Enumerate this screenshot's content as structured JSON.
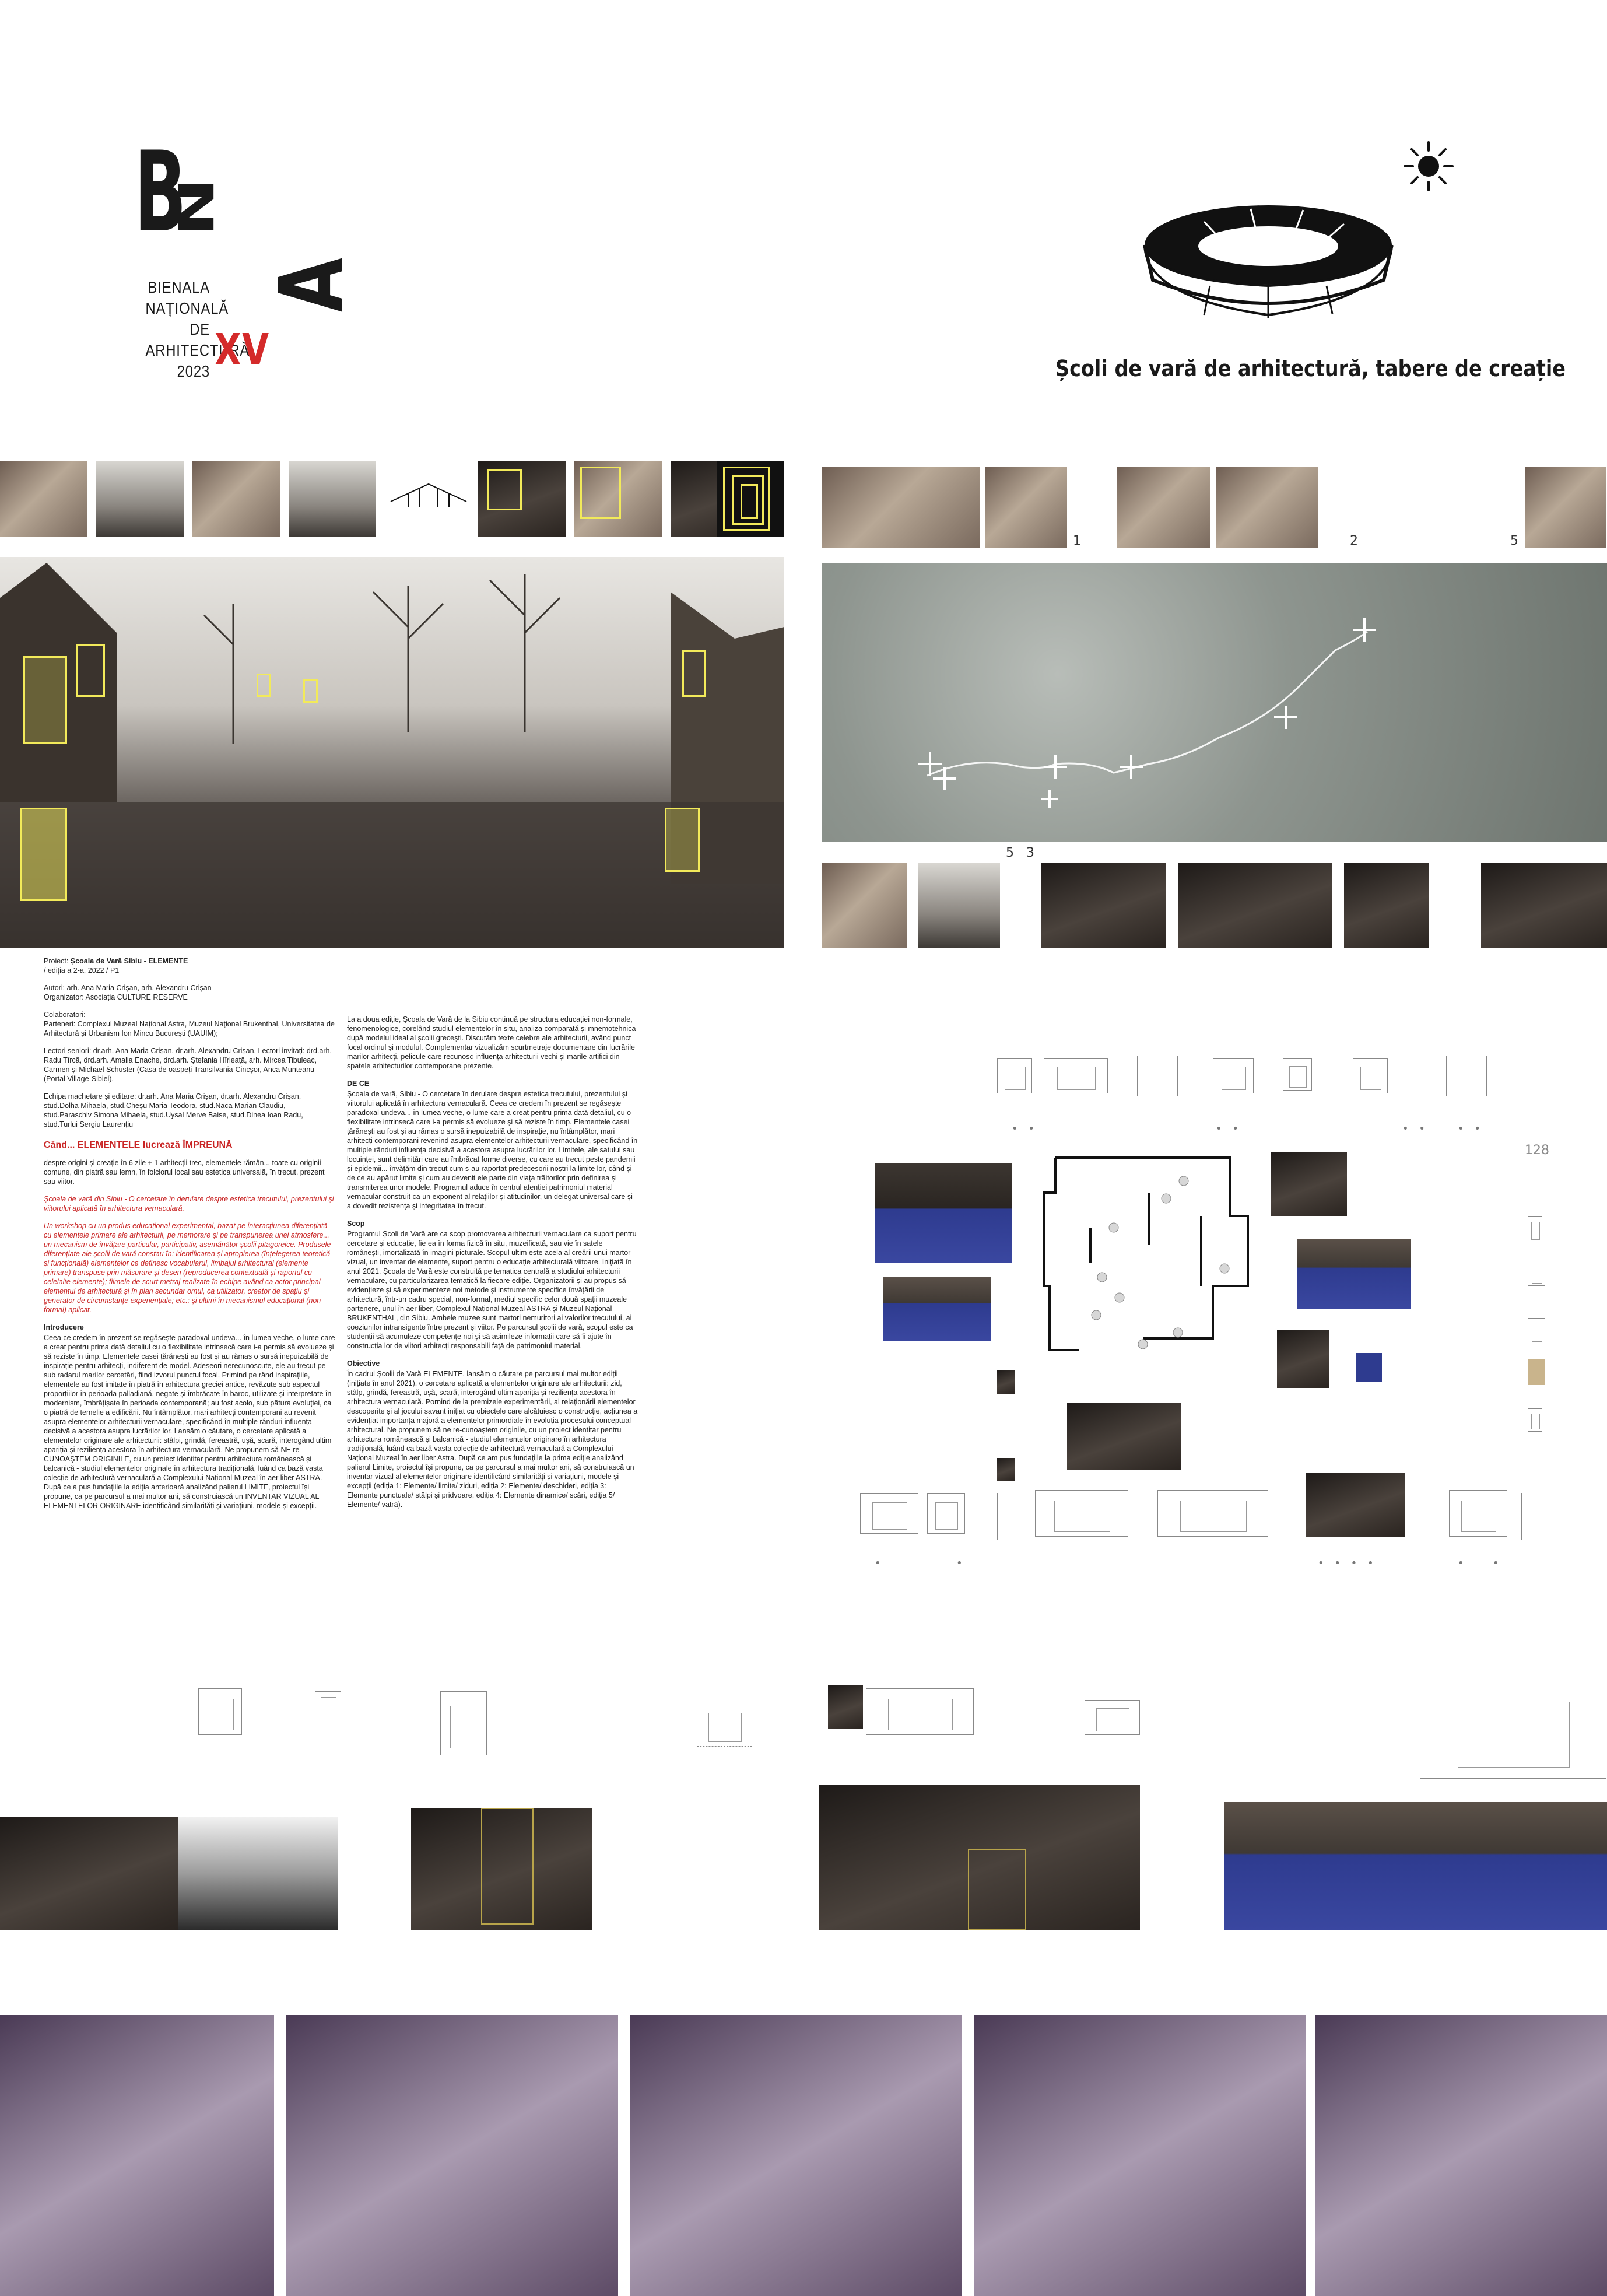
{
  "header": {
    "logo": {
      "b": "B",
      "n": "N",
      "a": "A",
      "lines": [
        "BIENALA",
        "NAȚIONALĂ",
        "DE",
        "ARHITECTURĂ",
        "2023"
      ],
      "edition": "XV"
    },
    "section_title": "Școli de vară de arhitectură, tabere de creație",
    "icons": [
      "sun-icon",
      "ring-pavilion-icon"
    ]
  },
  "map_markers": [
    "1",
    "2",
    "5"
  ],
  "strip_markers": [
    "5",
    "3"
  ],
  "drawing_label": "128",
  "project": {
    "title_prefix": "Proiect: ",
    "title": "Școala de Vară Sibiu - ELEMENTE",
    "edition": "/ ediția a 2-a, 2022 / P1",
    "authors": "Autori: arh. Ana Maria Crișan, arh. Alexandru Crișan",
    "organizer": "Organizator: Asociația CULTURE RESERVE",
    "collab_title": "Colaboratori:",
    "partners": "Parteneri: Complexul Muzeal Național Astra, Muzeul Național Brukenthal, Universitatea de Arhitectură și Urbanism Ion Mincu București (UAUIM);",
    "lecturers": "Lectori seniori: dr.arh. Ana Maria Crișan, dr.arh. Alexandru Crișan. Lectori invitați: drd.arh. Radu Tîrcă, drd.arh. Amalia Enache, drd.arh. Ștefania Hîrleață, arh. Mircea Tibuleac, Carmen și Michael Schuster (Casa de oaspeți Transilvania-Cincșor, Anca Munteanu (Portal Village-Sibiel).",
    "team": "Echipa machetare și editare: dr.arh. Ana Maria Crișan, dr.arh. Alexandru Crișan, stud.Dolha Mihaela, stud.Cheșu Maria Teodora, stud.Naca Marian Claudiu, stud.Paraschiv Simona Mihaela, stud.Uysal Merve Baise, stud.Dinea Ioan Radu, stud.Turlui Sergiu Laurențiu",
    "headline": "Când... ELEMENTELE lucrează ÎMPREUNĂ",
    "poem": "despre origini și creație în 6 zile + 1 arhitecții trec, elementele rămân... toate cu originii comune, din piatră sau lemn, în folclorul local sau estetica universală, în trecut, prezent sau viitor.",
    "red1": "Școala de vară din Sibiu - O cercetare în derulare despre estetica trecutului, prezentului și viitorului aplicată în arhitectura vernaculară.",
    "red2": "Un workshop cu un produs educațional experimental, bazat pe interacțiunea diferențiată cu elementele primare ale arhitecturii, pe memorare și pe transpunerea unei atmosfere... un mecanism de învățare particular, participativ, asemănător școlii pitagoreice. Produsele diferențiate ale școlii de vară constau în: identificarea și apropierea (înțelegerea teoretică și funcțională) elementelor ce definesc vocabularul, limbajul arhitectural (elemente primare) transpuse prin măsurare și desen (reproducerea contextuală și raportul cu celelalte elemente); filmele de scurt metraj realizate în echipe având ca actor principal elementul de arhitectură și în plan secundar omul, ca utilizator, creator de spațiu și generator de circumstanțe experiențiale; etc.; și ultimi în mecanismul educațional (non-formal) aplicat.",
    "intro_title": "Introducere",
    "intro": "Ceea ce credem în prezent se regăsește paradoxal undeva... în lumea veche, o lume care a creat pentru prima dată detaliul cu o flexibilitate intrinsecă care i-a permis să evolueze și să reziste în timp. Elementele casei țărănești au fost și au rămas o sursă inepuizabilă de inspirație pentru arhitecți, indiferent de model. Adeseori nerecunoscute, ele au trecut pe sub radarul marilor cercetări, fiind izvorul punctul focal. Primind pe rând inspirațiile, elementele au fost imitate în piatră în arhitectura greciei antice, revăzute sub aspectul proporțiilor în perioada palladiană, negate și îmbrăcate în baroc, utilizate și interpretate în modernism, îmbrățișate în perioada contemporană; au fost acolo, sub pătura evoluției, ca o piatră de temelie a edificării. Nu întâmplător, mari arhitecți contemporani au revenit asupra elementelor arhitecturii vernaculare, specificând în multiple rânduri influența decisivă a acestora asupra lucrărilor lor. Lansăm o căutare, o cercetare aplicată a elementelor originare ale arhitecturii: stâlpi, grindă, fereastră, ușă, scară, interogând ultim apariția și reziliența acestora în arhitectura vernaculară. Ne propunem să NE re-CUNOAȘTEM ORIGINILE, cu un proiect identitar pentru arhitectura românească și balcanică - studiul elementelor originale în arhitectura tradițională, luând ca bază vasta colecție de arhitectură vernaculară a Complexului Național Muzeal în aer liber ASTRA. După ce a pus fundațiile la ediția anterioară analizând palierul LIMITE, proiectul își propune, ca pe parcursul a mai multor ani, să construiască un INVENTAR VIZUAL AL ELEMENTELOR ORIGINARE identificând similarități și variațiuni, modele și excepții.",
    "c2_intro": "La a doua ediție, Școala de Vară de la Sibiu continuă pe structura educației non-formale, fenomenologice, corelând studiul elementelor în situ, analiza comparată și mnemotehnica după modelul ideal al școlii grecești. Discutăm texte celebre ale arhitecturii, având punct focal ordinul și modulul. Complementar vizualizăm scurtmetraje documentare din lucrările marilor arhitecți, pelicule care recunosc influența arhitecturii vechi și marile artifici din spatele arhitecturilor contemporane prezente.",
    "dece_title": "DE CE",
    "dece": "Școala de vară, Sibiu - O cercetare în derulare despre estetica trecutului, prezentului și viitorului aplicată în arhitectura vernaculară. Ceea ce credem în prezent se regăsește paradoxal undeva... în lumea veche, o lume care a creat pentru prima dată detaliul, cu o flexibilitate intrinsecă care i-a permis să evolueze și să reziste în timp. Elementele casei țărănești au fost și au rămas o sursă inepuizabilă de inspirație, nu întâmplător, mari arhitecți contemporani revenind asupra elementelor arhitecturii vernaculare, specificând în multiple rânduri influența decisivă a acestora asupra lucrărilor lor. Limitele, ale satului sau locuinței, sunt delimitări care au îmbrăcat forme diverse, cu care au trecut peste pandemii și epidemii... învățăm din trecut cum s-au raportat predecesorii noștri la limite lor, când și de ce au apărut limite și cum au devenit ele parte din viața trăitorilor prin definirea și transmiterea unor modele. Programul aduce în centrul atenției patrimoniul material vernacular construit ca un exponent al relațiilor și atitudinilor, un delegat universal care și-a dovedit rezistența și integritatea în trecut.",
    "scop_title": "Scop",
    "scop": "Programul Școli de Vară are ca scop promovarea arhitecturii vernaculare ca suport pentru cercetare și educație, fie ea în forma fizică în situ, muzeificată, sau vie în satele românești, imortalizată în imagini picturale. Scopul ultim este acela al creării unui martor vizual, un inventar de elemente, suport pentru o educație arhitecturală viitoare. Inițiată în anul 2021, Școala de Vară este construită pe tematica centrală a studiului arhitecturii vernaculare, cu particularizarea tematică la fiecare ediție. Organizatorii și au propus să evidențieze și să experimenteze noi metode și instrumente specifice învățării de arhitectură, într-un cadru special, non-formal, mediul specific celor două spații muzeale partenere, unul în aer liber, Complexul Național Muzeal ASTRA și Muzeul Național BRUKENTHAL, din Sibiu. Ambele muzee sunt martori nemuritori ai valorilor trecutului, ai coeziunilor intransigente între prezent și viitor. Pe parcursul școlii de vară, scopul este ca studenții să acumuleze competențe noi și să asimileze informații care să îi ajute în construcția lor de viitori arhitecți responsabili față de patrimoniul material.",
    "obiective_title": "Obiective",
    "obiective": "În cadrul Școlii de Vară ELEMENTE, lansăm o căutare pe parcursul mai multor ediții (inițiate în anul 2021), o cercetare aplicată a elementelor originare ale arhitecturii: zid, stâlp, grindă, fereastră, ușă, scară, interogând ultim apariția și reziliența acestora în arhitectura vernaculară. Pornind de la premizele experimentării, al relaționării elementelor descoperite și al jocului savant inițiat cu obiectele care alcătuiesc o construcție, acțiunea a evidențiat importanța majoră a elementelor primordiale în evoluția procesului conceptual arhitectural. Ne propunem să ne re-cunoaștem originile, cu un proiect identitar pentru arhitectura românească și balcanică - studiul elementelor originare în arhitectura tradițională, luând ca bază vasta colecție de arhitectură vernaculară a Complexului Național Muzeal în aer liber Astra. După ce am pus fundațiile la prima ediție analizând palierul Limite, proiectul își propune, ca pe parcursul a mai multor ani, să construiască un inventar vizual al elementelor originare identificând similarități și variațiuni, modele și excepții (ediția 1: Elemente/ limite/ ziduri, ediția 2: Elemente/ deschideri, ediția 3: Elemente punctuale/ stâlpi și pridvoare, ediția 4: Elemente dinamice/ scări, ediția 5/ Elemente/ vatră)."
  },
  "colors": {
    "accent_red": "#d42a2a",
    "highlight_yellow": "#f2ea5a",
    "museum_blue": "#3a47a0"
  }
}
